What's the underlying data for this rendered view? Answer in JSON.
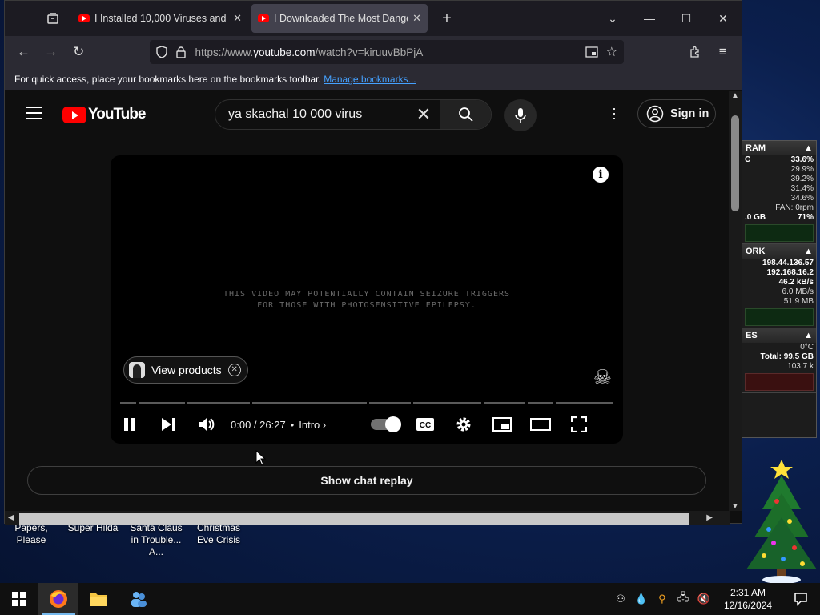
{
  "desktop": {
    "icons": [
      {
        "label": "Papers, Please"
      },
      {
        "label": "Super Hilda"
      },
      {
        "label": "Santa Claus in Trouble... A..."
      },
      {
        "label": "Christmas Eve Crisis"
      }
    ],
    "gadget": {
      "ram_title": "RAM",
      "cpu_rows": [
        "33.6%",
        "29.9%",
        "39.2%",
        "31.4%",
        "34.6%",
        "FAN: 0rpm"
      ],
      "cpu_label": "C",
      "mem": {
        "label": ".0 GB",
        "value": "71%"
      },
      "network_title": "ORK",
      "network_rows": [
        "198.44.136.57",
        "192.168.16.2",
        "46.2 kB/s",
        "6.0 MB/s",
        "51.9 MB"
      ],
      "drives_title": "ES",
      "drive_rows": [
        "0°C",
        "Total: 99.5 GB",
        "103.7 k"
      ]
    }
  },
  "browser": {
    "tabs": [
      {
        "title": "I Installed 10,000 Viruses and Th",
        "active": false
      },
      {
        "title": "I Downloaded The Most Dange",
        "active": true
      }
    ],
    "url": {
      "prefix": "https://www.",
      "host": "youtube.com",
      "path": "/watch?v=kiruuvBbPjA"
    },
    "bookmarks_text": "For quick access, place your bookmarks here on the bookmarks toolbar.",
    "bookmarks_link": "Manage bookmarks..."
  },
  "youtube": {
    "logo_text": "YouTube",
    "search_query": "ya skachal 10 000 virus",
    "sign_in": "Sign in",
    "player": {
      "warning_line1": "THIS VIDEO MAY POTENTIALLY CONTAIN SEIZURE TRIGGERS",
      "warning_line2": "FOR THOSE WITH PHOTOSENSITIVE EPILEPSY.",
      "view_products": "View products",
      "time": "0:00 / 26:27",
      "chapter": "Intro",
      "chapter_segments": [
        3,
        9,
        12,
        22,
        8,
        13,
        8,
        5,
        11
      ]
    },
    "chat_replay": "Show chat replay"
  },
  "taskbar": {
    "time": "2:31 AM",
    "date": "12/16/2024"
  }
}
